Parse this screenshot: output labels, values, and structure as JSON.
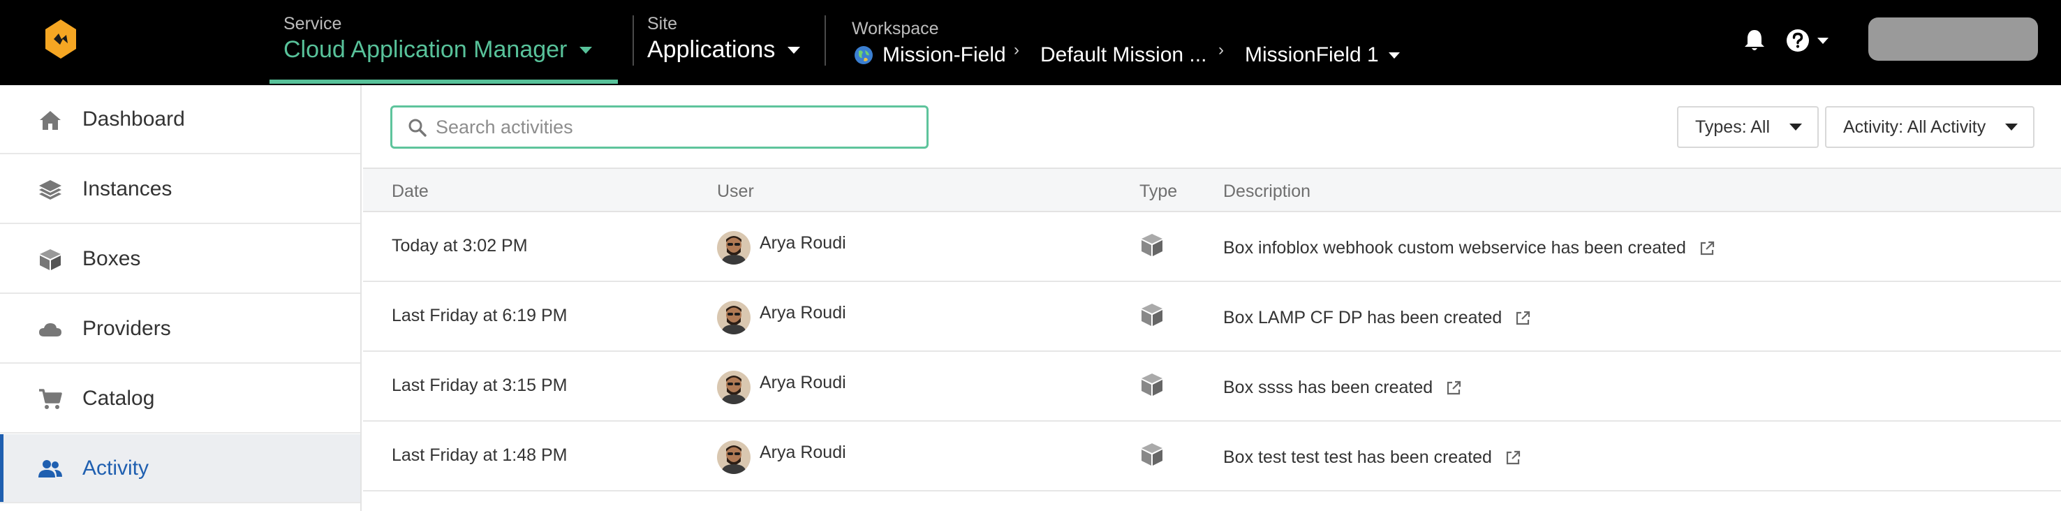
{
  "header": {
    "logo": "diamond-logo",
    "service": {
      "label": "Service",
      "value": "Cloud Application Manager",
      "accent": "#58c29a"
    },
    "site": {
      "label": "Site",
      "value": "Applications"
    },
    "workspace": {
      "label": "Workspace",
      "crumbs": [
        "Mission-Field",
        "Default Mission ...",
        "MissionField 1"
      ]
    },
    "icons": [
      "bell-icon",
      "help-icon"
    ],
    "user_placeholder_color": "#9a9a9a"
  },
  "sidebar": {
    "active_color": "#1f5fb0",
    "items": [
      {
        "label": "Dashboard",
        "icon": "home-icon"
      },
      {
        "label": "Instances",
        "icon": "layers-icon"
      },
      {
        "label": "Boxes",
        "icon": "box-icon"
      },
      {
        "label": "Providers",
        "icon": "cloud-icon"
      },
      {
        "label": "Catalog",
        "icon": "cart-icon"
      },
      {
        "label": "Activity",
        "icon": "users-icon",
        "active": true
      }
    ]
  },
  "search": {
    "placeholder": "Search activities",
    "value": ""
  },
  "filters": {
    "types": "Types: All",
    "activity": "Activity: All Activity"
  },
  "table": {
    "columns": [
      "Date",
      "User",
      "Type",
      "Description"
    ],
    "rows": [
      {
        "date": "Today at 3:02 PM",
        "user": "Arya Roudi",
        "type": "box-icon",
        "description": "Box infoblox webhook custom webservice has been created"
      },
      {
        "date": "Last Friday at 6:19 PM",
        "user": "Arya Roudi",
        "type": "box-icon",
        "description": "Box LAMP CF DP has been created"
      },
      {
        "date": "Last Friday at 3:15 PM",
        "user": "Arya Roudi",
        "type": "box-icon",
        "description": "Box ssss has been created"
      },
      {
        "date": "Last Friday at 1:48 PM",
        "user": "Arya Roudi",
        "type": "box-icon",
        "description": "Box test test test has been created"
      }
    ]
  }
}
